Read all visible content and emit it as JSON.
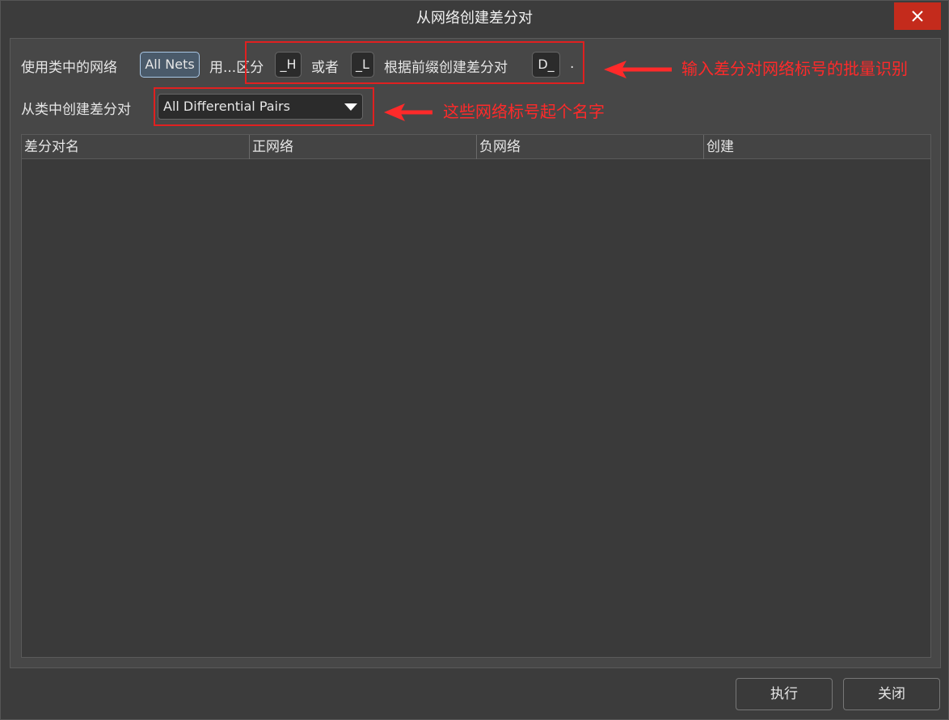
{
  "window": {
    "title": "从网络创建差分对"
  },
  "row1": {
    "label_use_nets": "使用类中的网络",
    "net_class_button": "All Nets",
    "label_distinguish": "用...区分",
    "suffix_positive": "_H",
    "label_or": "或者",
    "suffix_negative": "_L",
    "label_prefix": "根据前缀创建差分对",
    "prefix_value": "D_",
    "trailing_dot": "."
  },
  "row2": {
    "label_from_class": "从类中创建差分对",
    "dropdown_value": "All Differential Pairs"
  },
  "annotations": {
    "note1": "输入差分对网络标号的批量识别",
    "note2": "这些网络标号起个名字",
    "color": "#ff2a2a"
  },
  "table": {
    "columns": [
      "差分对名",
      "正网络",
      "负网络",
      "创建"
    ]
  },
  "footer": {
    "execute_label": "执行",
    "close_label": "关闭"
  }
}
